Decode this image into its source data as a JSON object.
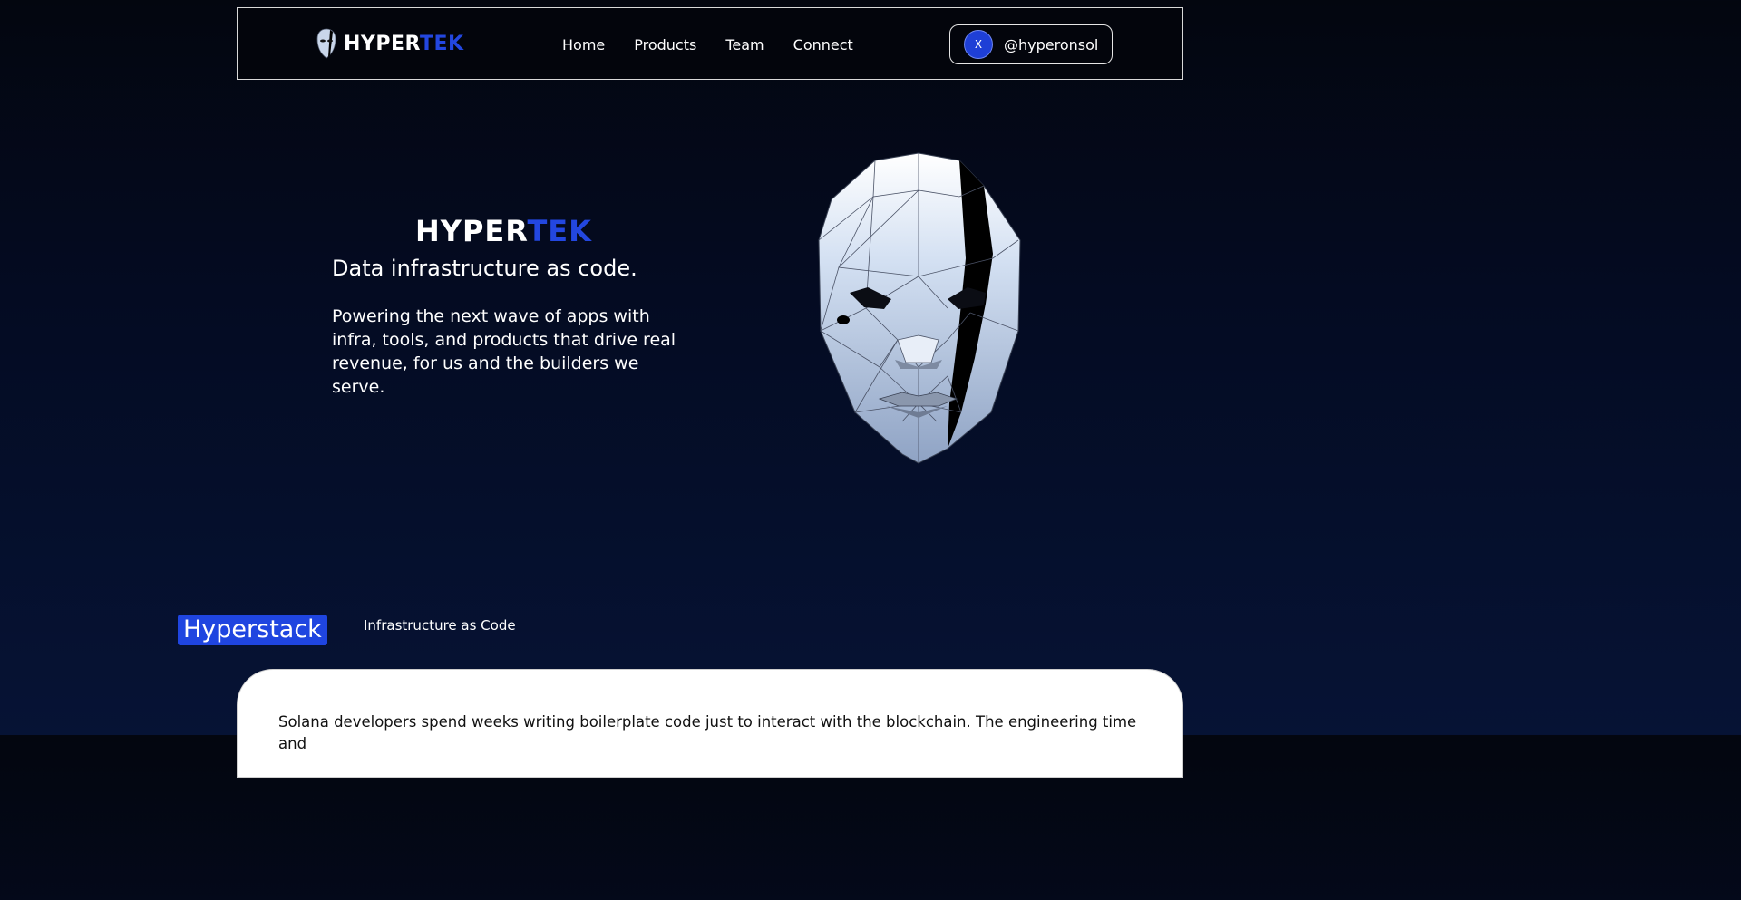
{
  "nav": {
    "brand_a": "HYPER",
    "brand_b": "TEK",
    "links": [
      "Home",
      "Products",
      "Team",
      "Connect"
    ],
    "social": {
      "icon": "x-icon",
      "icon_text": "X",
      "handle": "@hyperonsol"
    }
  },
  "hero": {
    "brand_a": "HYPER",
    "brand_b": "TEK",
    "tagline": "Data infrastructure as code.",
    "description": "Powering the next wave of apps with infra, tools, and products that drive real revenue, for us and the builders we serve."
  },
  "section": {
    "badge": "Hyperstack",
    "subtitle": "Infrastructure as Code",
    "body": "Solana developers spend weeks writing boilerplate code just to interact with the blockchain. The engineering time and"
  },
  "colors": {
    "accent": "#2347e0",
    "background": "#040b22",
    "card": "#ffffff"
  }
}
